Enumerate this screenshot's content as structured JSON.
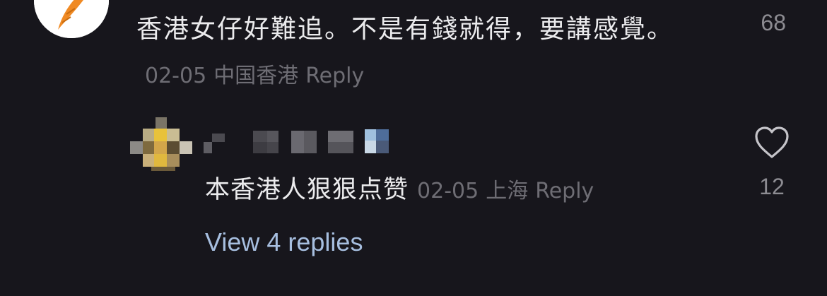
{
  "comment": {
    "text": "香港女仔好難追。不是有錢就得，要講感覺。",
    "date": "02-05",
    "location": "中国香港",
    "reply_label": "Reply",
    "like_count": "68",
    "avatar_icon": "carrot-icon"
  },
  "reply": {
    "username_obscured": true,
    "text": "本香港人狠狠点赞",
    "date": "02-05",
    "location": "上海",
    "reply_label": "Reply",
    "like_count": "12",
    "like_icon": "heart-outline-icon"
  },
  "view_replies": {
    "label": "View 4 replies"
  },
  "colors": {
    "background": "#17161c",
    "primary_text": "#ebebed",
    "meta_text": "#6e6d74",
    "count_text": "#8d8c92",
    "link_text": "#a7bfe0"
  }
}
